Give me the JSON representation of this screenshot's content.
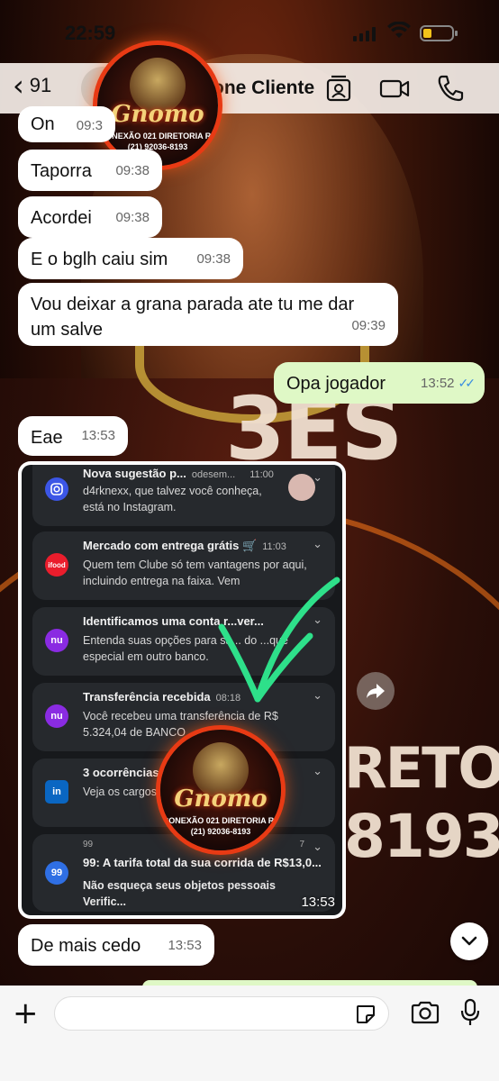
{
  "status_bar": {
    "time": "22:59"
  },
  "header": {
    "back_count": "91",
    "contact_name": "one Cliente"
  },
  "logo": {
    "brand": "Gnomo",
    "line1": "CONEXÃO 021 DIRETORIA RJ",
    "line2": "(21) 92036-8193"
  },
  "wallpaper": {
    "big_text": "3ES",
    "big_text_2": "RETORI",
    "big_number": "8193"
  },
  "messages": [
    {
      "text": "On",
      "time": "09:3",
      "direction": "in"
    },
    {
      "text": "Taporra",
      "time": "09:38",
      "direction": "in"
    },
    {
      "text": "Acordei",
      "time": "09:38",
      "direction": "in"
    },
    {
      "text": "E o bglh caiu sim",
      "time": "09:38",
      "direction": "in"
    },
    {
      "text": "Vou deixar a grana parada ate tu me dar um salve",
      "time": "09:39",
      "direction": "in"
    },
    {
      "text": "Opa jogador",
      "time": "13:52",
      "direction": "out",
      "status": "read"
    },
    {
      "text": "Eae",
      "time": "13:53",
      "direction": "in"
    },
    {
      "text": "De mais cedo",
      "time": "13:53",
      "direction": "in"
    }
  ],
  "image_message": {
    "time": "13:53",
    "notifications": [
      {
        "app": "instagram-icon",
        "app_color": "#3c56e6",
        "title": "Nova sugestão p...",
        "extra": "odesem...",
        "time": "11:00",
        "body": "d4rknexx, que talvez você conheça, está no Instagram."
      },
      {
        "app": "ifood-icon",
        "app_color": "#ea1d2c",
        "app_label": "ifood",
        "title": "Mercado com entrega grátis 🛒",
        "time": "11:03",
        "body": "Quem tem Clube só tem vantagens por aqui, incluindo entrega na faixa. Vem"
      },
      {
        "app": "nubank-icon",
        "app_color": "#8a2be2",
        "app_label": "nu",
        "title": "Identificamos uma conta r...ver...",
        "time": "",
        "body": "Entenda suas opções para sa... do ...que especial em outro banco."
      },
      {
        "app": "nubank-icon",
        "app_color": "#8a2be2",
        "app_label": "nu",
        "title": "Transferência recebida",
        "time": "08:18",
        "body": "Você recebeu uma transferência de R$ 5.324,04 de BANCO ..."
      },
      {
        "app": "linkedin-icon",
        "app_color": "#0a66c2",
        "app_label": "in",
        "title": "3 ocorrências d...",
        "time": "",
        "body": "Veja os cargos... perfil foi pesqu..."
      },
      {
        "app": "99-icon",
        "app_color": "#2f6fe4",
        "app_label": "99",
        "header": "99",
        "count": "7",
        "title": "99: A tarifa total da sua corrida de R$13,0...",
        "time": "",
        "body": "Não esqueça seus objetos pessoais Verific..."
      }
    ]
  },
  "composer": {
    "placeholder": ""
  }
}
